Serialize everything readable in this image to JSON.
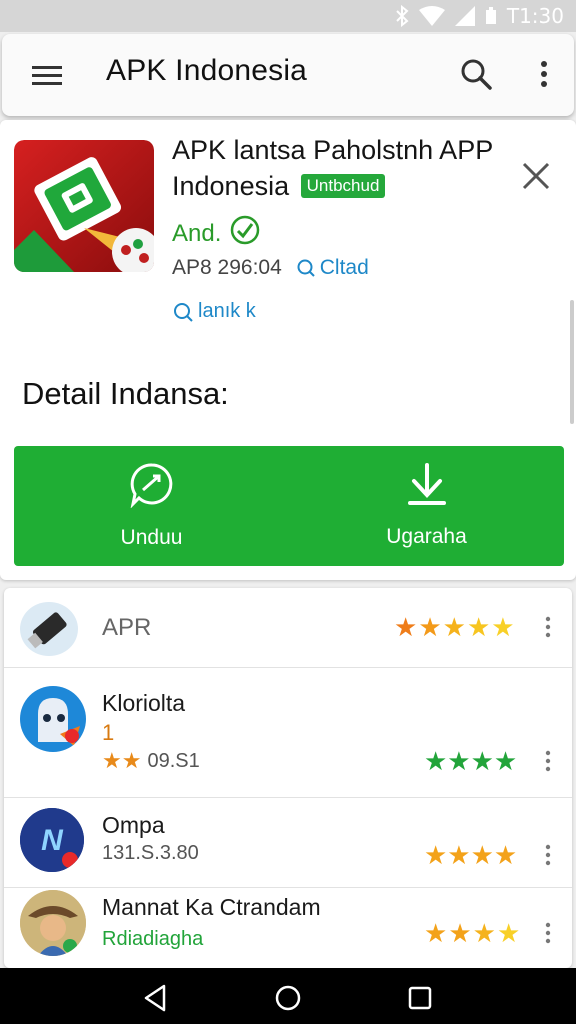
{
  "status_bar": {
    "time": "T1:30",
    "icons": [
      "bluetooth-icon",
      "wifi-icon",
      "signal-icon",
      "battery-icon"
    ]
  },
  "app_bar": {
    "title": "APK Indonesia",
    "icons": [
      "menu-icon",
      "search-icon",
      "more-vert-icon"
    ]
  },
  "app_detail": {
    "name": "APK lantsa Paholstnh APP Indonesia",
    "name_line1": "APK lantsa Paholstnh APP",
    "name_line2": "Indonesia",
    "badge": "Untbchud",
    "developer": "And.",
    "meta": "AP8 296:04",
    "meta_link": "Cltad",
    "link": "lanık k",
    "section_heading": "Detail Indansa:",
    "actions": [
      {
        "label": "Unduu",
        "icon": "share-bubble-icon"
      },
      {
        "label": "Ugaraha",
        "icon": "download-icon"
      }
    ],
    "colors": {
      "accent": "#1fae34",
      "badge": "#25a83b",
      "link": "#1e88c8",
      "developer": "#2a9b2a"
    }
  },
  "list": [
    {
      "name": "APR",
      "subtitle": "",
      "rating_stars": 5,
      "star_color": "mixed-orange-yellow",
      "icon": "usb-drive-icon"
    },
    {
      "name": "Kloriolta",
      "line2": "1",
      "subtitle": "09.S1",
      "subtitle_stars": 2,
      "rating_stars": 4,
      "star_color": "#22a43a",
      "icon": "ghost-avatar-icon"
    },
    {
      "name": "Ompa",
      "subtitle": "131.S.3.80",
      "rating_stars": 4,
      "star_color": "#f3a21a",
      "icon": "n-logo-icon"
    },
    {
      "name": "Mannat Ka Ctrandam",
      "subtitle": "Rdiadiagha",
      "rating_stars": 4,
      "star_color": "#f3a21a",
      "icon": "cowboy-avatar-icon"
    }
  ],
  "nav_bar": {
    "icons": [
      "back-icon",
      "home-icon",
      "recents-icon"
    ]
  }
}
